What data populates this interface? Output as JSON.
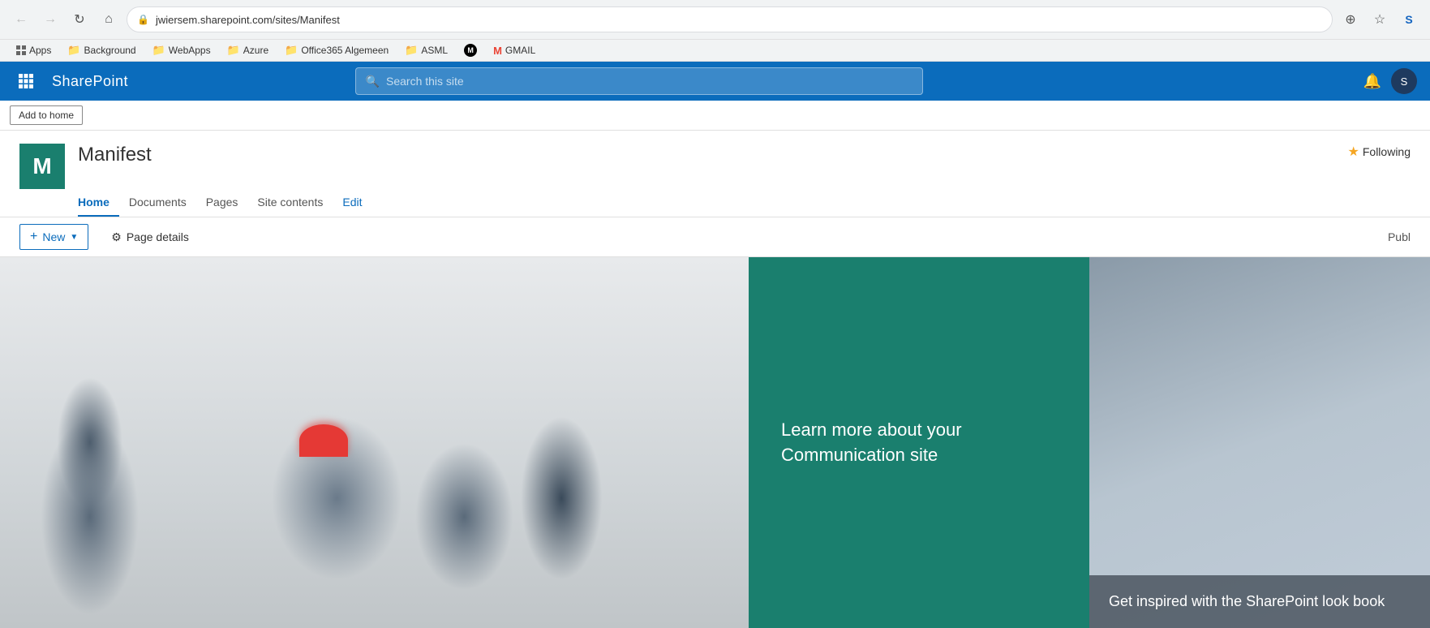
{
  "browser": {
    "back_disabled": true,
    "forward_disabled": true,
    "url": "jwiersem.sharepoint.com/sites/Manifest",
    "protocol_icon": "🔒"
  },
  "bookmarks": {
    "items": [
      {
        "id": "apps",
        "label": "Apps",
        "icon": "grid",
        "type": "apps"
      },
      {
        "id": "background",
        "label": "Background",
        "icon": "folder",
        "type": "folder"
      },
      {
        "id": "webapps",
        "label": "WebApps",
        "icon": "folder",
        "type": "folder"
      },
      {
        "id": "azure",
        "label": "Azure",
        "icon": "folder",
        "type": "folder"
      },
      {
        "id": "office365",
        "label": "Office365 Algemeen",
        "icon": "folder",
        "type": "folder"
      },
      {
        "id": "asml",
        "label": "ASML",
        "icon": "folder",
        "type": "folder"
      },
      {
        "id": "monday",
        "label": "",
        "icon": "circle-m",
        "type": "app"
      },
      {
        "id": "gmail",
        "label": "GMAIL",
        "icon": "m-gmail",
        "type": "app"
      }
    ]
  },
  "sharepoint_header": {
    "waffle_label": "Microsoft 365",
    "logo_text": "SharePoint",
    "search_placeholder": "Search this site",
    "bell_label": "Notifications",
    "profile_initials": "S"
  },
  "add_to_home": {
    "button_label": "Add to home"
  },
  "site": {
    "logo_letter": "M",
    "logo_color": "#1a7f6e",
    "title": "Manifest",
    "following_label": "Following",
    "nav_items": [
      {
        "id": "home",
        "label": "Home",
        "active": true
      },
      {
        "id": "documents",
        "label": "Documents",
        "active": false
      },
      {
        "id": "pages",
        "label": "Pages",
        "active": false
      },
      {
        "id": "site-contents",
        "label": "Site contents",
        "active": false
      },
      {
        "id": "edit",
        "label": "Edit",
        "active": false,
        "is_link": true
      }
    ]
  },
  "toolbar": {
    "new_label": "New",
    "page_details_label": "Page details",
    "publish_label": "Publ"
  },
  "hero": {
    "teal_panel": {
      "title": "Learn more about your Communication site"
    },
    "right_panel": {
      "title": "Get inspired with the SharePoint look book"
    }
  }
}
